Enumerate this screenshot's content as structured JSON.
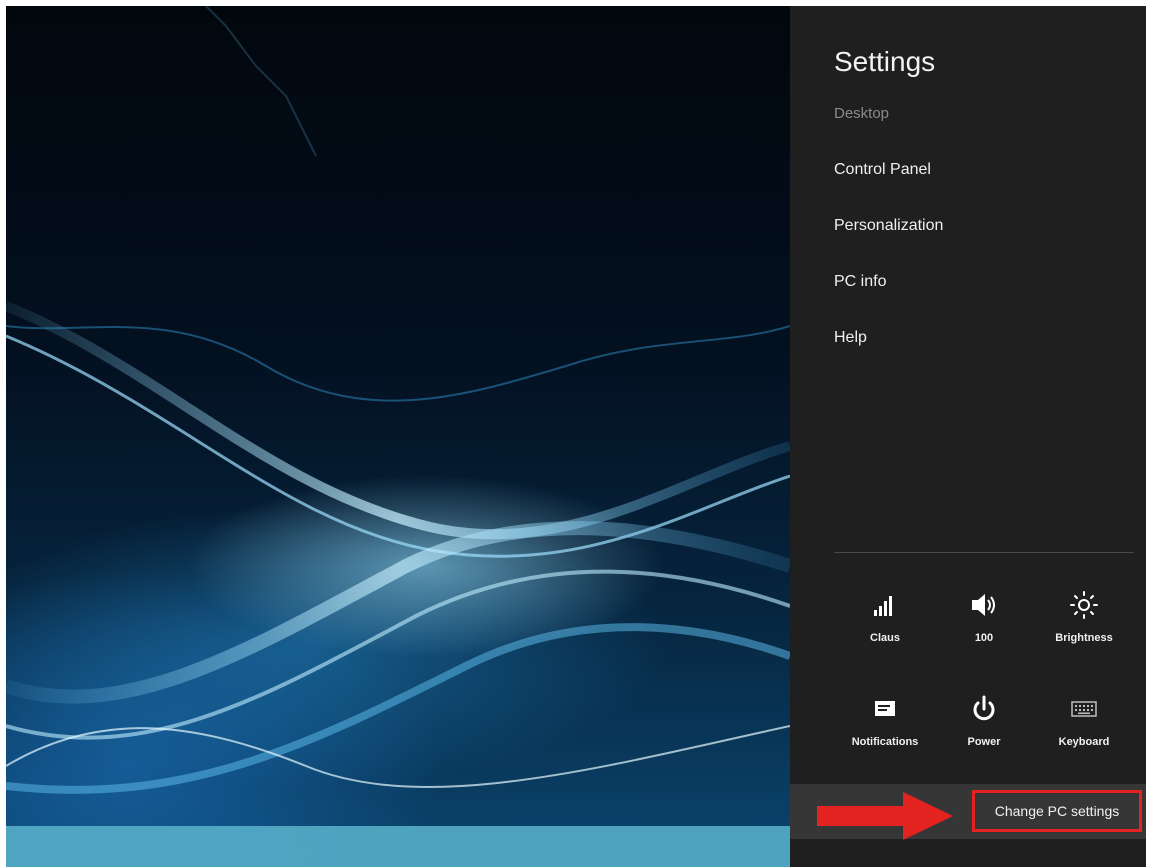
{
  "charm": {
    "title": "Settings",
    "context": "Desktop",
    "menu_items": [
      "Control Panel",
      "Personalization",
      "PC info",
      "Help"
    ]
  },
  "quick_settings": [
    {
      "label": "Claus",
      "icon": "network-signal-icon"
    },
    {
      "label": "100",
      "icon": "volume-icon"
    },
    {
      "label": "Brightness",
      "icon": "brightness-icon"
    },
    {
      "label": "Notifications",
      "icon": "notifications-icon"
    },
    {
      "label": "Power",
      "icon": "power-icon"
    },
    {
      "label": "Keyboard",
      "icon": "keyboard-icon"
    }
  ],
  "change_pc_settings": "Change PC settings",
  "colors": {
    "charm_bg": "#1f1f1f",
    "highlight": "#e3231f",
    "taskbar": "#5ab4cd"
  }
}
